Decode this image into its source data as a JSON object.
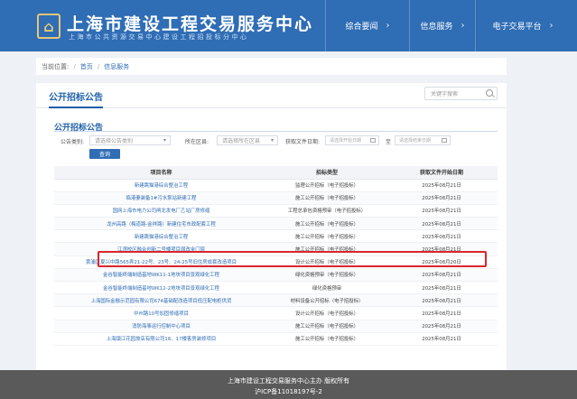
{
  "header": {
    "logo_glyph": "⌂",
    "title": "上海市建设工程交易服务中心",
    "subtitle": "上海市公共资源交易中心建设工程招投标分中心",
    "nav": [
      {
        "label": "综合要闻"
      },
      {
        "label": "信息服务"
      },
      {
        "label": "电子交易平台"
      }
    ],
    "chevron_glyph": "›"
  },
  "breadcrumb": {
    "prefix": "当前位置:",
    "home": "首页",
    "current": "信息服务",
    "separator": "/"
  },
  "panel": {
    "title": "公开招标公告",
    "search_placeholder": "关键字搜索"
  },
  "section": {
    "title": "公开招标公告"
  },
  "filters": {
    "category_label": "公告类别:",
    "category_placeholder": "请选择公告类别",
    "region_label": "所在区县:",
    "region_placeholder": "请选择所在区县",
    "date_label": "获取文件日期:",
    "date_start_placeholder": "请选择开始日期",
    "date_to": "至",
    "date_end_placeholder": "请选择结束日期",
    "query_button": "查询"
  },
  "table": {
    "headers": [
      "项目名称",
      "招标类型",
      "获取文件开始日期"
    ],
    "rows": [
      {
        "name": "新建跳猫港综合整治工程",
        "type": "监理公开招标（电子招投标）",
        "date": "2025年08月21日"
      },
      {
        "name": "临港妻装备1#污水泵站新建工程",
        "type": "施工公开招标（电子招投标）",
        "date": "2025年08月21日"
      },
      {
        "name": "国网上海市电力公司闸北发电厂乙站厂房修缮",
        "type": "工程总承包资格预审（电子招投标）",
        "date": "2025年08月21日"
      },
      {
        "name": "龙州高路（梅道路-金祥路）新建住宅市政配套工程",
        "type": "施工公开招标（电子招投标）",
        "date": "2025年08月21日"
      },
      {
        "name": "新建跳猫港综合整治工程",
        "type": "施工公开招标（电子招投标）",
        "date": "2025年08月21日"
      },
      {
        "name": "江湾校区融合创新二号楼项目弱改金门窗",
        "type": "施工公开招标（电子招投标）",
        "date": "2025年08月21日"
      },
      {
        "name": "黄浦区夏兴中路565弄21-22号、23号、24-25号旧住房成套改造项目",
        "type": "设计公开招标（电子招投标）",
        "date": "2025年08月20日"
      },
      {
        "name": "金谷智能终端制造基地WK11-1地块项目景观绿化工程",
        "type": "绿化资格预审（电子招投标）",
        "date": "2025年08月21日"
      },
      {
        "name": "金谷智能终端制造基地WK12-2地块项目景观绿化工程",
        "type": "绿化资格预审",
        "date": "2025年08月21日"
      },
      {
        "name": "上海国际金融示范园有限公司674基础配改造项目低压配电柜供货",
        "type": "材料设备公开招标（电子招投标）",
        "date": "2025年08月21日"
      },
      {
        "name": "中州路10号加固修缮项目",
        "type": "设计公开招标（电子招投标）",
        "date": "2025年08月21日"
      },
      {
        "name": "消防海事运行控制中心项目",
        "type": "施工公开招标（电子招投标）",
        "date": "2025年08月21日"
      },
      {
        "name": "上海镇江花园旅店有限公司16、17楼客房装修项目",
        "type": "施工公开招标（电子招投标）",
        "date": "2025年08月21日"
      }
    ]
  },
  "footer": {
    "line1": "上海市建设工程交易服务中心主办 版权所有",
    "line2": "沪ICP备11018197号-2"
  },
  "colors": {
    "header_blue": "#2f6db5",
    "accent_gold": "#e5c878",
    "highlight_red": "#d9262c",
    "footer_gray": "#5a5a5a"
  }
}
